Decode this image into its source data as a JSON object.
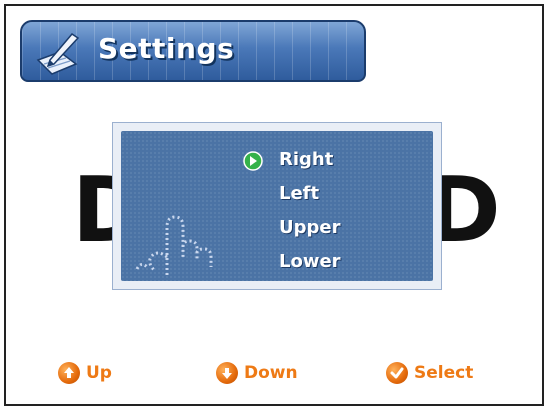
{
  "header": {
    "title": "Settings",
    "icon": "pen-and-paper-icon"
  },
  "menu": {
    "items": [
      {
        "label": "Right",
        "selected": true
      },
      {
        "label": "Left",
        "selected": false
      },
      {
        "label": "Upper",
        "selected": false
      },
      {
        "label": "Lower",
        "selected": false
      }
    ],
    "selected_icon": "green-arrow-icon",
    "illustration": "hand-pointing-icon"
  },
  "softkeys": {
    "up": {
      "label": "Up",
      "icon": "up-arrow-circle-icon"
    },
    "down": {
      "label": "Down",
      "icon": "down-arrow-circle-icon"
    },
    "select": {
      "label": "Select",
      "icon": "check-circle-icon"
    }
  },
  "colors": {
    "header_blue": "#4a78b8",
    "panel_blue": "#4b73a5",
    "softkey_orange": "#ee7a15"
  }
}
